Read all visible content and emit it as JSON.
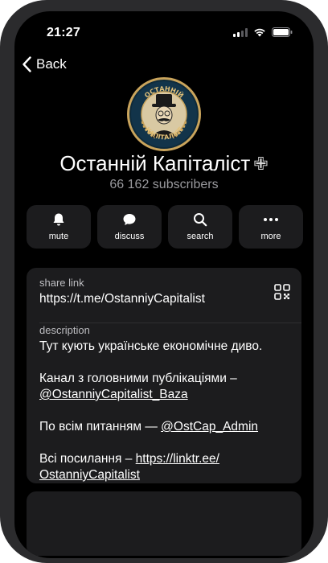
{
  "status_bar": {
    "time": "21:27"
  },
  "nav": {
    "back_label": "Back"
  },
  "channel": {
    "name": "Останній Капіталіст",
    "badge": "✙",
    "subscribers": "66 162 subscribers",
    "avatar_text_top": "ОСТАННІЙ",
    "avatar_text_bottom": "КАПІТАЛІСТ"
  },
  "actions": [
    {
      "label": "mute",
      "icon": "bell-icon"
    },
    {
      "label": "discuss",
      "icon": "chat-bubble-icon"
    },
    {
      "label": "search",
      "icon": "search-icon"
    },
    {
      "label": "more",
      "icon": "more-dots-icon"
    }
  ],
  "info": {
    "share_link_label": "share link",
    "share_link_value": "https://t.me/OstanniyCapitalist",
    "description_label": "description",
    "description_line1": "Тут кують українське економічне диво.",
    "description_line2_text": "Канал з головними публікаціями –",
    "description_line2_link": "@OstanniyCapitalist_Baza",
    "description_line3_text": "По всім питанням — ",
    "description_line3_link": "@OstCap_Admin",
    "description_line4_text": "Всі посилання – ",
    "description_line4_link_a": "https://linktr.ee/",
    "description_line4_link_b": "OstanniyCapitalist"
  }
}
